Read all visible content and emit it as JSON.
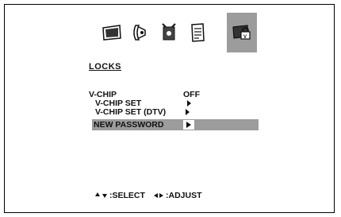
{
  "menu": {
    "title": "LOCKS",
    "items": [
      {
        "label": "V-CHIP",
        "value": "OFF"
      },
      {
        "label": "V-CHIP SET",
        "value": ""
      },
      {
        "label": "V-CHIP SET (DTV)",
        "value": ""
      },
      {
        "label": "NEW PASSWORD",
        "value": ""
      }
    ],
    "selected_index": 3
  },
  "tabs": [
    {
      "icon": "picture-icon",
      "active": false
    },
    {
      "icon": "audio-icon",
      "active": false
    },
    {
      "icon": "setup-icon",
      "active": false
    },
    {
      "icon": "features-icon",
      "active": false
    },
    {
      "icon": "locks-icon",
      "active": true
    }
  ],
  "footer": {
    "select_label": ":SELECT",
    "adjust_label": ":ADJUST"
  },
  "colors": {
    "highlight": "#9c9c9c",
    "text": "#111111",
    "background": "#ffffff"
  }
}
